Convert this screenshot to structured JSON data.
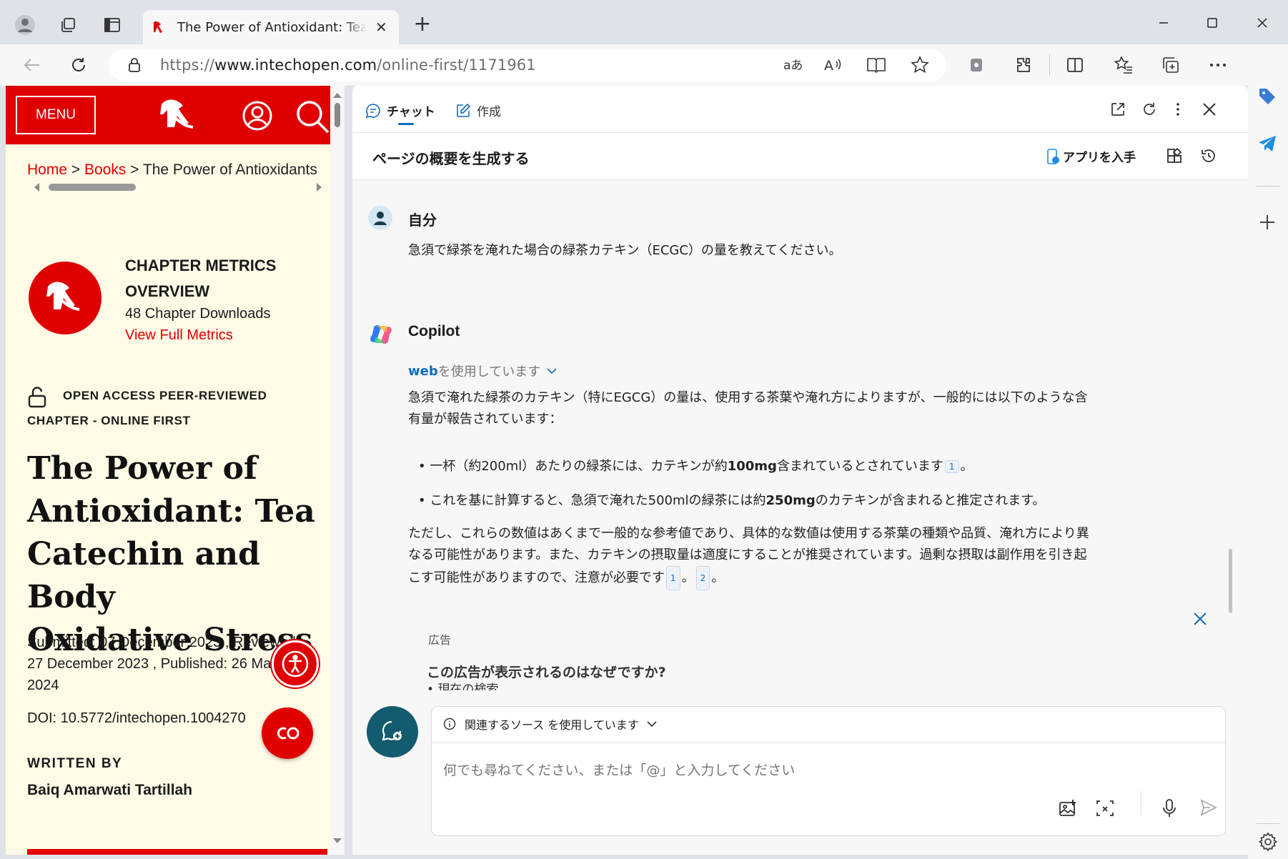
{
  "browser": {
    "tab_title": "The Power of Antioxidant: Tea Ca",
    "url_prefix": "https://",
    "url_domain": "www.intechopen.com",
    "url_path": "/online-first/1171961",
    "new_tab_symbol": "+",
    "tab_close_symbol": "✕"
  },
  "left_page": {
    "menu_label": "MENU",
    "breadcrumb": {
      "home": "Home",
      "sep1": " > ",
      "books": "Books",
      "sep2": " > ",
      "current": "The Power of Antioxidants"
    },
    "metrics_heading_1": "CHAPTER METRICS",
    "metrics_heading_2": "OVERVIEW",
    "downloads": "48 Chapter Downloads",
    "view_metrics": "View Full Metrics",
    "access_label_1": "OPEN ACCESS PEER-REVIEWED",
    "access_label_2": "CHAPTER - ONLINE FIRST",
    "title_lines": [
      "The Power of",
      "Antioxidant: Tea",
      "Catechin and Body",
      "Oxidative Stress"
    ],
    "dates_lines": [
      "Submitted: 07 December 2023 , Reviewed:",
      "27 December 2023 , Published: 26 March",
      "2024"
    ],
    "doi": "DOI: 10.5772/intechopen.1004270",
    "written_by": "WRITTEN BY",
    "author": "Baiq Amarwati Tartillah"
  },
  "copilot": {
    "tab_chat": "チャット",
    "tab_compose": "作成",
    "generate_summary": "ページの概要を生成する",
    "get_app": "アプリを入手",
    "user_name": "自分",
    "user_question": "急須で緑茶を淹れた場合の緑茶カテキン（ECGC）の量を教えてください。",
    "bot_name": "Copilot",
    "web_label": "web",
    "using_label": " を使用しています",
    "answer_intro_1": "急須で淹れた緑茶のカテキン（特にEGCG）の量は、使用する茶葉や淹れ方によりますが、一般的には以下のような含",
    "answer_intro_2": "有量が報告されています：",
    "bullet1_a": "一杯（約200ml）あたりの緑茶には、カテキンが約",
    "bullet1_b": "100mg",
    "bullet1_c": "含まれているとされています",
    "bullet1_cite": "1",
    "bullet1_end": "。",
    "bullet2_a": "これを基に計算すると、急須で淹れた500mlの緑茶には約",
    "bullet2_b": "250mg",
    "bullet2_c": "のカテキンが含まれると推定されます。",
    "para_1": "ただし、これらの数値はあくまで一般的な参考値であり、具体的な数値は使用する茶葉の種類や品質、淹れ方により異",
    "para_2": "なる可能性があります。また、カテキンの摂取量は適度にすることが推奨されています。過剰な摂取は副作用を引き起",
    "para_3": "こす可能性がありますので、注意が必要です",
    "para_cite1": "1",
    "para_sep": "。",
    "para_cite2": "2",
    "para_end": "。",
    "ad_label": "広告",
    "ad_question": "この広告が表示されるのはなぜですか?",
    "ad_item": "現在の検索",
    "sources_label": "関連するソース を使用しています",
    "input_placeholder": "何でも尋ねてください、または「@」と入力してください"
  }
}
